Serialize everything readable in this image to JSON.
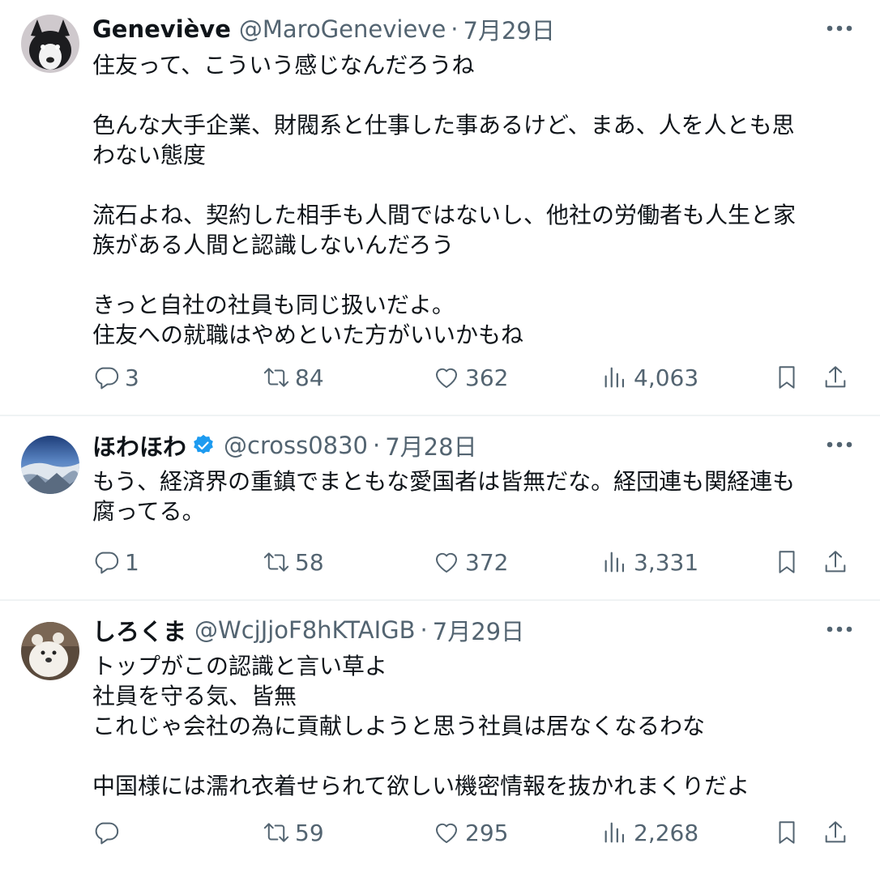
{
  "tweets": [
    {
      "name": "Geneviève",
      "handle": "@MaroGenevieve",
      "separator": "·",
      "date": "7月29日",
      "verified": false,
      "text": "住友って、こういう感じなんだろうね\n\n色んな大手企業、財閥系と仕事した事あるけど、まあ、人を人とも思\nわない態度\n\n流石よね、契約した相手も人間ではないし、他社の労働者も人生と家\n族がある人間と認識しないんだろう\n\nきっと自社の社員も同じ扱いだよ。\n住友への就職はやめといた方がいいかもね",
      "replies": "3",
      "retweets": "84",
      "likes": "362",
      "views": "4,063"
    },
    {
      "name": "ほわほわ",
      "handle": "@cross0830",
      "separator": "·",
      "date": "7月28日",
      "verified": true,
      "text": "もう、経済界の重鎮でまともな愛国者は皆無だな。経団連も関経連も\n腐ってる。",
      "replies": "1",
      "retweets": "58",
      "likes": "372",
      "views": "3,331"
    },
    {
      "name": "しろくま",
      "handle": "@WcjJjoF8hKTAIGB",
      "separator": "·",
      "date": "7月29日",
      "verified": false,
      "text": "トップがこの認識と言い草よ\n社員を守る気、皆無\nこれじゃ会社の為に貢献しようと思う社員は居なくなるわな\n\n中国様には濡れ衣着せられて欲しい機密情報を抜かれまくりだよ",
      "replies": "",
      "retweets": "59",
      "likes": "295",
      "views": "2,268"
    }
  ],
  "icons": {
    "more": "more-icon",
    "reply": "reply-icon",
    "retweet": "retweet-icon",
    "like": "heart-icon",
    "views": "views-icon",
    "bookmark": "bookmark-icon",
    "share": "share-icon",
    "verified": "verified-badge-icon"
  },
  "colors": {
    "text": "#0f1419",
    "secondary": "#536471",
    "verified": "#1d9bf0",
    "divider": "#eff3f4"
  }
}
